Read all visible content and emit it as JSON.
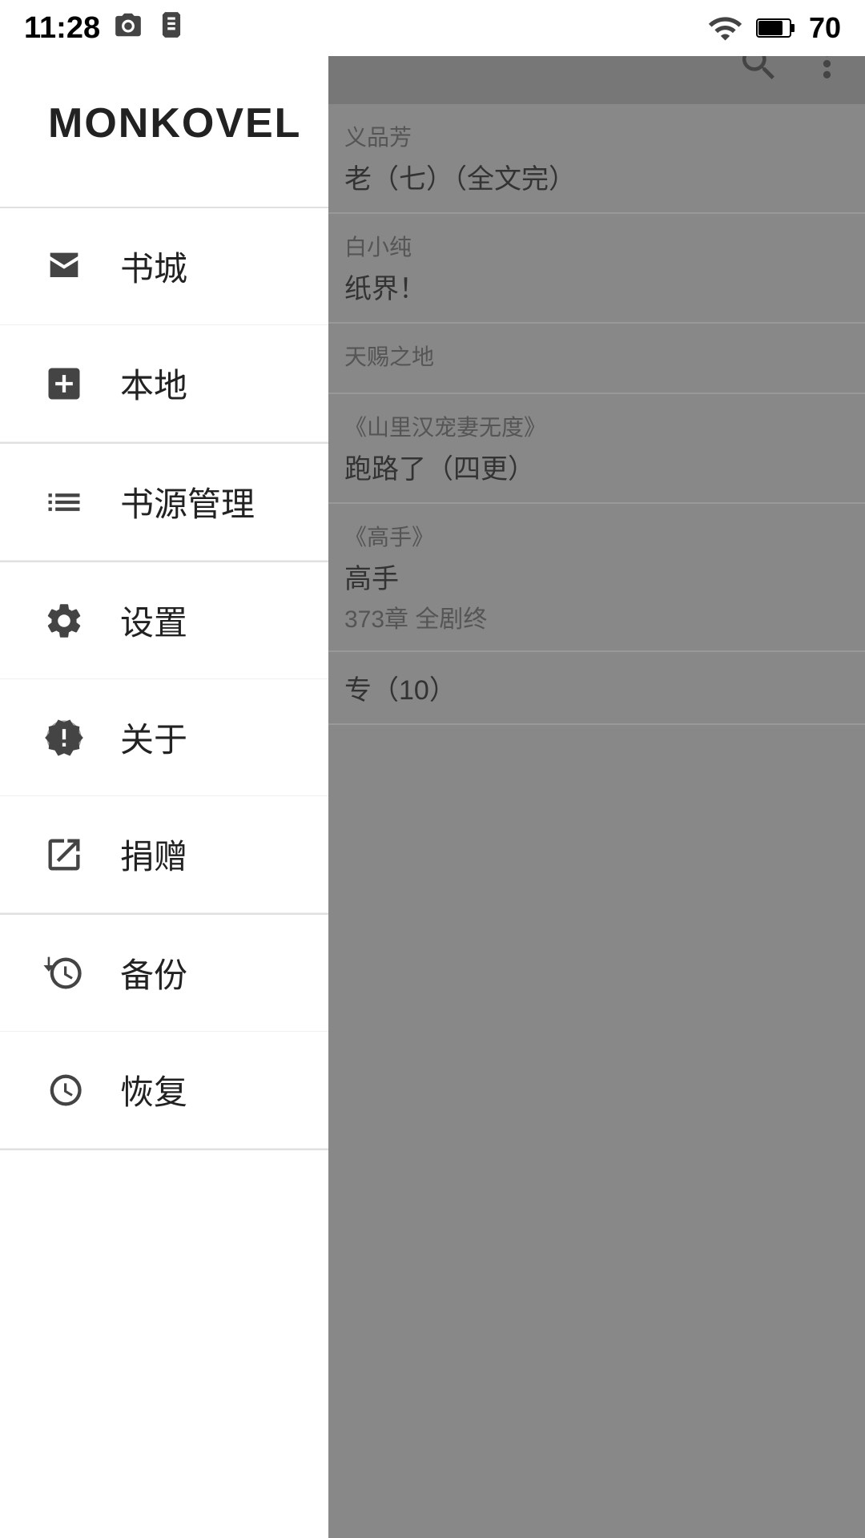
{
  "statusBar": {
    "time": "11:28",
    "battery": "70"
  },
  "rightPanel": {
    "items": [
      {
        "sub": "义品芳",
        "title": "老（七）（全文完）"
      },
      {
        "sub": "白小纯",
        "title": "纸界！"
      },
      {
        "sub": "天赐之地",
        "title": ""
      },
      {
        "sub": "《山里汉宠妻无度》",
        "title": "跑路了（四更）"
      },
      {
        "sub": "《高手》",
        "title": "高手",
        "desc": "373章 全剧终"
      },
      {
        "sub": "",
        "title": "专（10）"
      }
    ]
  },
  "drawer": {
    "logo": "MONKOVEL",
    "items": [
      {
        "id": "bookstore",
        "label": "书城",
        "icon": "store"
      },
      {
        "id": "local",
        "label": "本地",
        "icon": "plus"
      },
      {
        "id": "source-manage",
        "label": "书源管理",
        "icon": "list"
      },
      {
        "id": "settings",
        "label": "设置",
        "icon": "gear"
      },
      {
        "id": "about",
        "label": "关于",
        "icon": "umbrella"
      },
      {
        "id": "donate",
        "label": "捐赠",
        "icon": "external-link"
      },
      {
        "id": "backup",
        "label": "备份",
        "icon": "backup"
      },
      {
        "id": "restore",
        "label": "恢复",
        "icon": "restore"
      }
    ]
  }
}
